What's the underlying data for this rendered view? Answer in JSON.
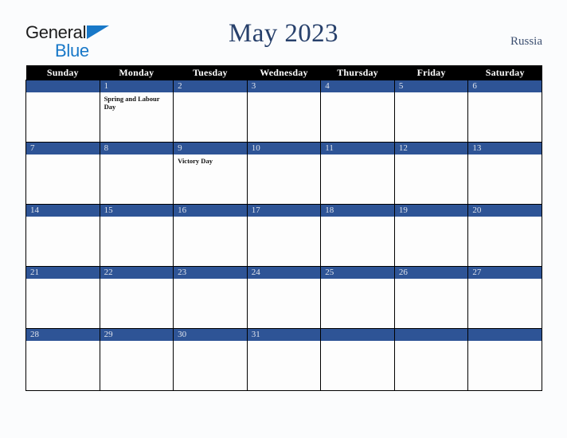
{
  "brand": {
    "name_part1": "General",
    "name_part2": "Blue",
    "triangle_icon": "triangle-icon"
  },
  "header": {
    "title": "May 2023",
    "country": "Russia"
  },
  "calendar": {
    "weekday_headers": [
      "Sunday",
      "Monday",
      "Tuesday",
      "Wednesday",
      "Thursday",
      "Friday",
      "Saturday"
    ],
    "colors": {
      "header_bg": "#000000",
      "header_text": "#ffffff",
      "daybar_bg": "#2e5496",
      "daybar_text": "#dfe3ec",
      "cell_bg": "#fdfdfd",
      "grid_line": "#000000",
      "page_bg": "#fbfcfd",
      "title_text": "#27406b",
      "brand_blue": "#1878c8"
    },
    "weeks": [
      [
        {
          "date": "",
          "events": []
        },
        {
          "date": "1",
          "events": [
            "Spring and Labour Day"
          ]
        },
        {
          "date": "2",
          "events": []
        },
        {
          "date": "3",
          "events": []
        },
        {
          "date": "4",
          "events": []
        },
        {
          "date": "5",
          "events": []
        },
        {
          "date": "6",
          "events": []
        }
      ],
      [
        {
          "date": "7",
          "events": []
        },
        {
          "date": "8",
          "events": []
        },
        {
          "date": "9",
          "events": [
            "Victory Day"
          ]
        },
        {
          "date": "10",
          "events": []
        },
        {
          "date": "11",
          "events": []
        },
        {
          "date": "12",
          "events": []
        },
        {
          "date": "13",
          "events": []
        }
      ],
      [
        {
          "date": "14",
          "events": []
        },
        {
          "date": "15",
          "events": []
        },
        {
          "date": "16",
          "events": []
        },
        {
          "date": "17",
          "events": []
        },
        {
          "date": "18",
          "events": []
        },
        {
          "date": "19",
          "events": []
        },
        {
          "date": "20",
          "events": []
        }
      ],
      [
        {
          "date": "21",
          "events": []
        },
        {
          "date": "22",
          "events": []
        },
        {
          "date": "23",
          "events": []
        },
        {
          "date": "24",
          "events": []
        },
        {
          "date": "25",
          "events": []
        },
        {
          "date": "26",
          "events": []
        },
        {
          "date": "27",
          "events": []
        }
      ],
      [
        {
          "date": "28",
          "events": []
        },
        {
          "date": "29",
          "events": []
        },
        {
          "date": "30",
          "events": []
        },
        {
          "date": "31",
          "events": []
        },
        {
          "date": "",
          "events": []
        },
        {
          "date": "",
          "events": []
        },
        {
          "date": "",
          "events": []
        }
      ]
    ]
  }
}
